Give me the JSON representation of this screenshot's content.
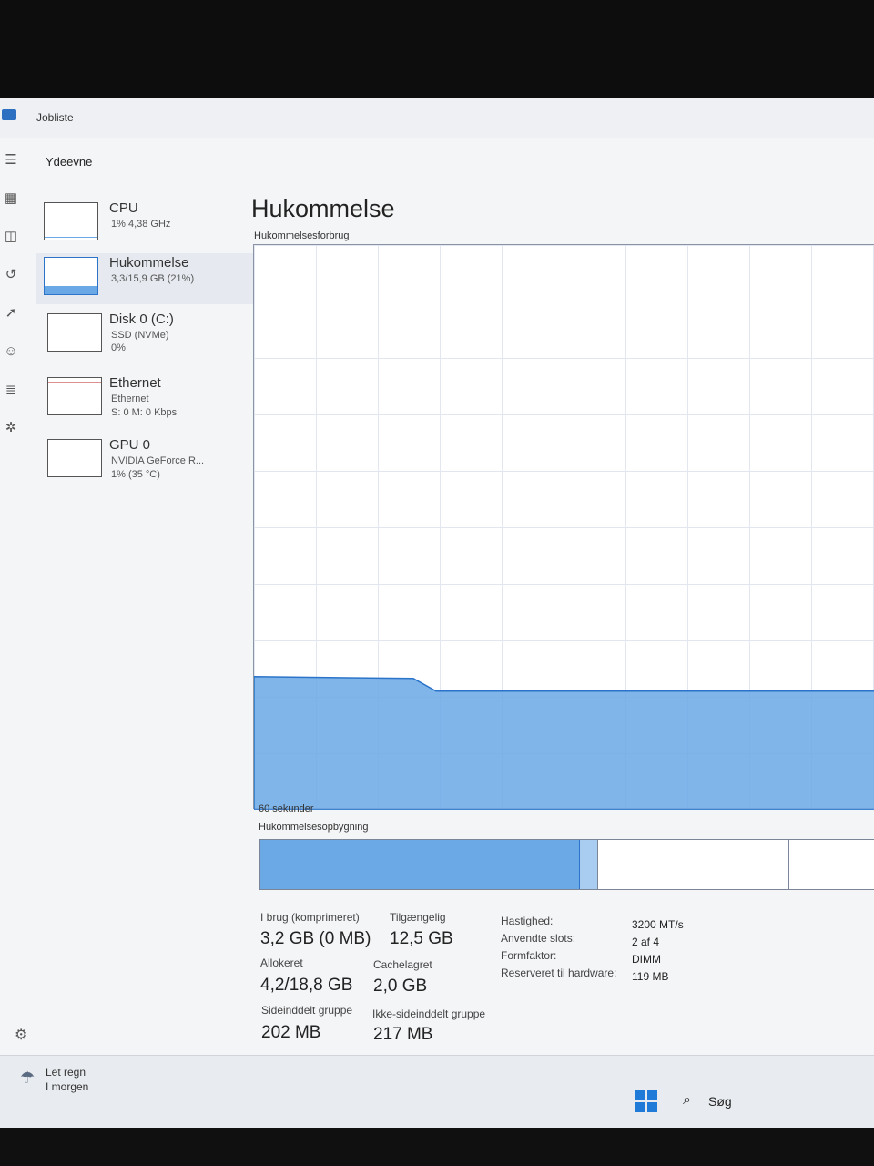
{
  "window": {
    "title": "Jobliste"
  },
  "sidebar": {
    "icons": [
      "menu-icon",
      "processes-icon",
      "performance-icon",
      "app-history-icon",
      "startup-icon",
      "users-icon",
      "details-icon",
      "services-icon"
    ],
    "settings_icon": "gear-icon"
  },
  "section_title": "Ydeevne",
  "devices": [
    {
      "name": "CPU",
      "line1": "1% 4,38 GHz",
      "line2": ""
    },
    {
      "name": "Hukommelse",
      "line1": "3,3/15,9 GB (21%)",
      "line2": ""
    },
    {
      "name": "Disk 0 (C:)",
      "line1": "SSD (NVMe)",
      "line2": "0%"
    },
    {
      "name": "Ethernet",
      "line1": "Ethernet",
      "line2": "S: 0 M: 0 Kbps"
    },
    {
      "name": "GPU 0",
      "line1": "NVIDIA GeForce R...",
      "line2": "1% (35 °C)"
    }
  ],
  "main": {
    "title": "Hukommelse",
    "usage_label": "Hukommelsesforbrug",
    "time_label": "60 sekunder",
    "composition_label": "Hukommelsesopbygning",
    "usage_percent": 21,
    "composition": {
      "in_use_fraction": 0.52,
      "modified_fraction": 0.03,
      "standby_fraction": 0.31
    }
  },
  "stats": {
    "in_use_label": "I brug (komprimeret)",
    "in_use_value": "3,2 GB (0 MB)",
    "available_label": "Tilgængelig",
    "available_value": "12,5 GB",
    "committed_label": "Allokeret",
    "committed_value": "4,2/18,8 GB",
    "cached_label": "Cachelagret",
    "cached_value": "2,0 GB",
    "paged_label": "Sideinddelt gruppe",
    "paged_value": "202 MB",
    "nonpaged_label": "Ikke-sideinddelt gruppe",
    "nonpaged_value": "217 MB"
  },
  "specs": [
    {
      "label": "Hastighed:",
      "value": "3200 MT/s"
    },
    {
      "label": "Anvendte slots:",
      "value": "2 af 4"
    },
    {
      "label": "Formfaktor:",
      "value": "DIMM"
    },
    {
      "label": "Reserveret til hardware:",
      "value": "119 MB"
    }
  ],
  "taskbar": {
    "weather_line1": "Let regn",
    "weather_line2": "I morgen",
    "search_label": "Søg",
    "accent": "#1f7ad8"
  },
  "colors": {
    "memory_fill": "#6aa8e6",
    "memory_line": "#2b74c9"
  }
}
